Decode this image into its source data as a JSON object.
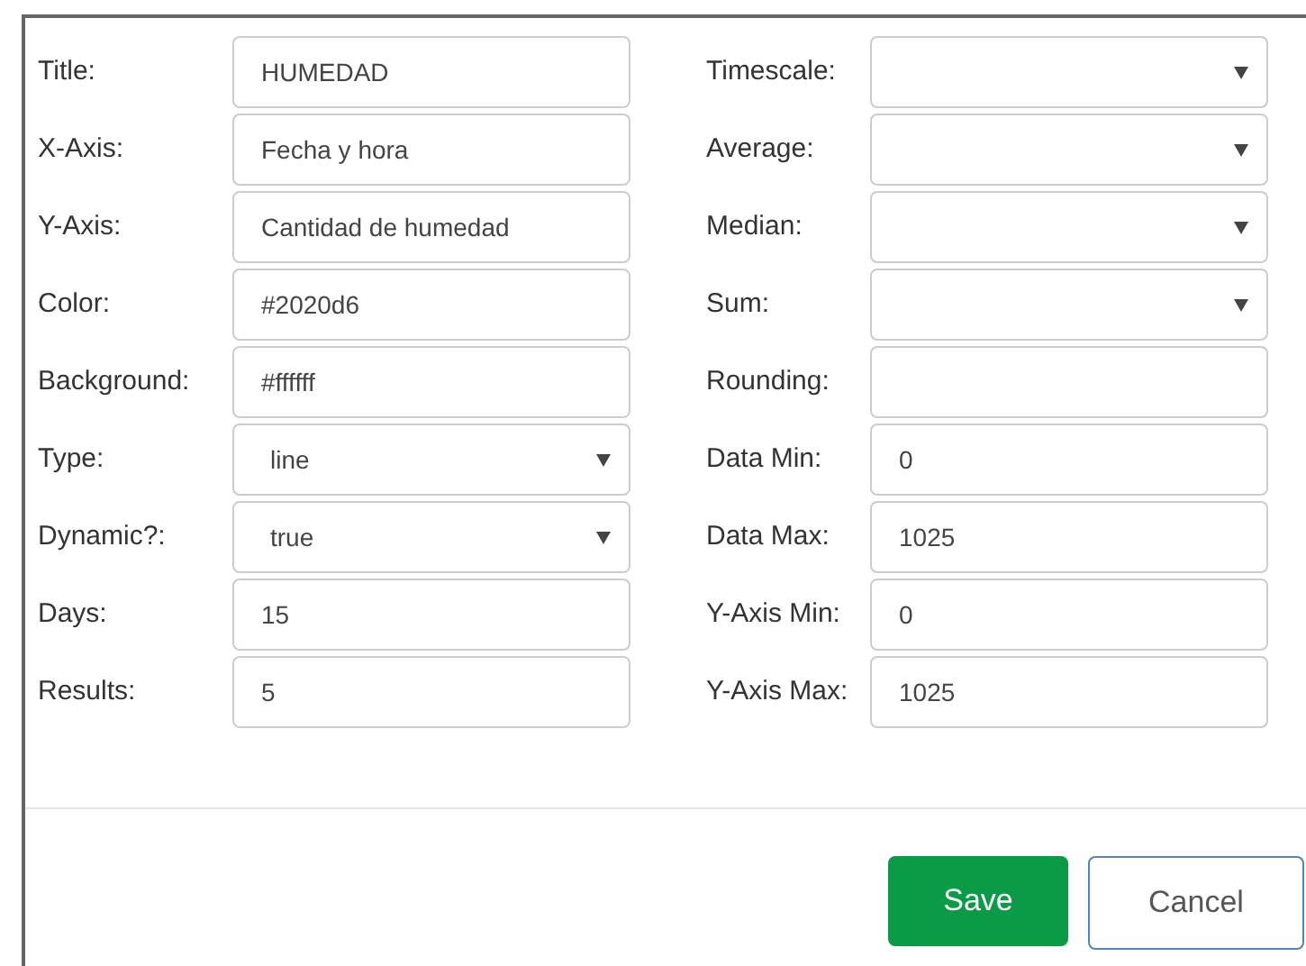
{
  "left_fields": [
    {
      "label": "Title:",
      "kind": "text",
      "value": "HUMEDAD"
    },
    {
      "label": "X-Axis:",
      "kind": "text",
      "value": "Fecha y hora"
    },
    {
      "label": "Y-Axis:",
      "kind": "text",
      "value": "Cantidad de humedad"
    },
    {
      "label": "Color:",
      "kind": "text",
      "value": "#2020d6"
    },
    {
      "label": "Background:",
      "kind": "text",
      "value": "#ffffff"
    },
    {
      "label": "Type:",
      "kind": "select",
      "value": "line"
    },
    {
      "label": "Dynamic?:",
      "kind": "select",
      "value": "true"
    },
    {
      "label": "Days:",
      "kind": "text",
      "value": "15"
    },
    {
      "label": "Results:",
      "kind": "text",
      "value": "5"
    }
  ],
  "right_fields": [
    {
      "label": "Timescale:",
      "kind": "select"
    },
    {
      "label": "Average:",
      "kind": "select"
    },
    {
      "label": "Median:",
      "kind": "select"
    },
    {
      "label": "Sum:",
      "kind": "select"
    },
    {
      "label": "Rounding:",
      "kind": "text"
    },
    {
      "label": "Data Min:",
      "kind": "text",
      "value": "0"
    },
    {
      "label": "Data Max:",
      "kind": "text",
      "value": "1025"
    },
    {
      "label": "Y-Axis Min:",
      "kind": "text",
      "value": "0"
    },
    {
      "label": "Y-Axis Max:",
      "kind": "text",
      "value": "1025"
    }
  ],
  "buttons": [
    {
      "label": "Save",
      "kind": "primary"
    },
    {
      "label": "Cancel",
      "kind": "secondary"
    }
  ]
}
